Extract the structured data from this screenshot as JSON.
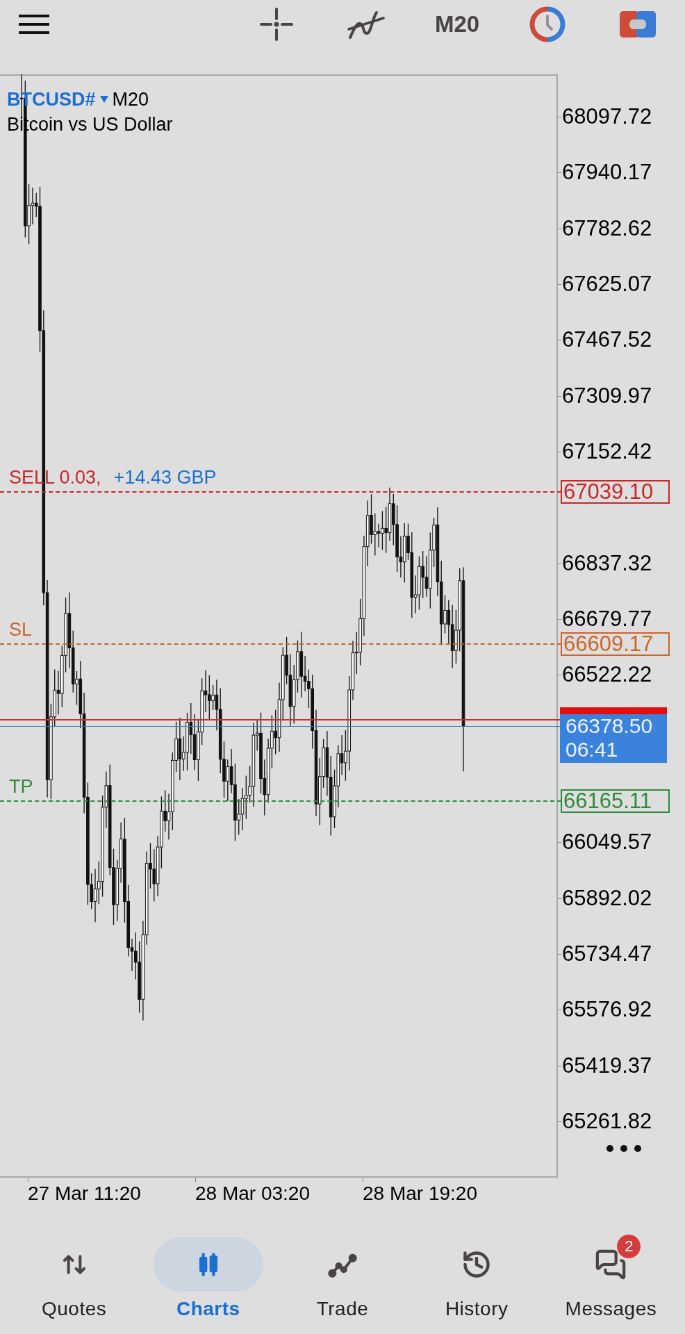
{
  "toolbar": {
    "timeframe": "M20"
  },
  "chart": {
    "symbol": "BTCUSD#",
    "timeframe": "M20",
    "description": "Bitcoin vs US Dollar",
    "price_ticks": [
      "68097.72",
      "67940.17",
      "67782.62",
      "67625.07",
      "67467.52",
      "67309.97",
      "67152.42",
      "66837.32",
      "66679.77",
      "66522.22",
      "66049.57",
      "65892.02",
      "65734.47",
      "65576.92",
      "65419.37",
      "65261.82"
    ],
    "time_labels": [
      "27 Mar 11:20",
      "28 Mar 03:20",
      "28 Mar 19:20"
    ],
    "lines": [
      {
        "label": "SELL 0.03,",
        "profit": "+14.43 GBP",
        "price": "67039.10",
        "color": "#c62828"
      },
      {
        "label": "SL",
        "price": "66609.17",
        "color": "#c8662a"
      },
      {
        "label": "TP",
        "price": "66165.11",
        "color": "#2e8b3a"
      }
    ],
    "current": {
      "price": "66378.50",
      "countdown": "06:41"
    }
  },
  "nav": [
    {
      "kind": "quotes",
      "label": "Quotes",
      "selected": false
    },
    {
      "kind": "charts",
      "label": "Charts",
      "selected": true
    },
    {
      "kind": "trade",
      "label": "Trade",
      "selected": false
    },
    {
      "kind": "history",
      "label": "History",
      "selected": false
    },
    {
      "kind": "messages",
      "label": "Messages",
      "selected": false,
      "badge": "2"
    }
  ]
}
